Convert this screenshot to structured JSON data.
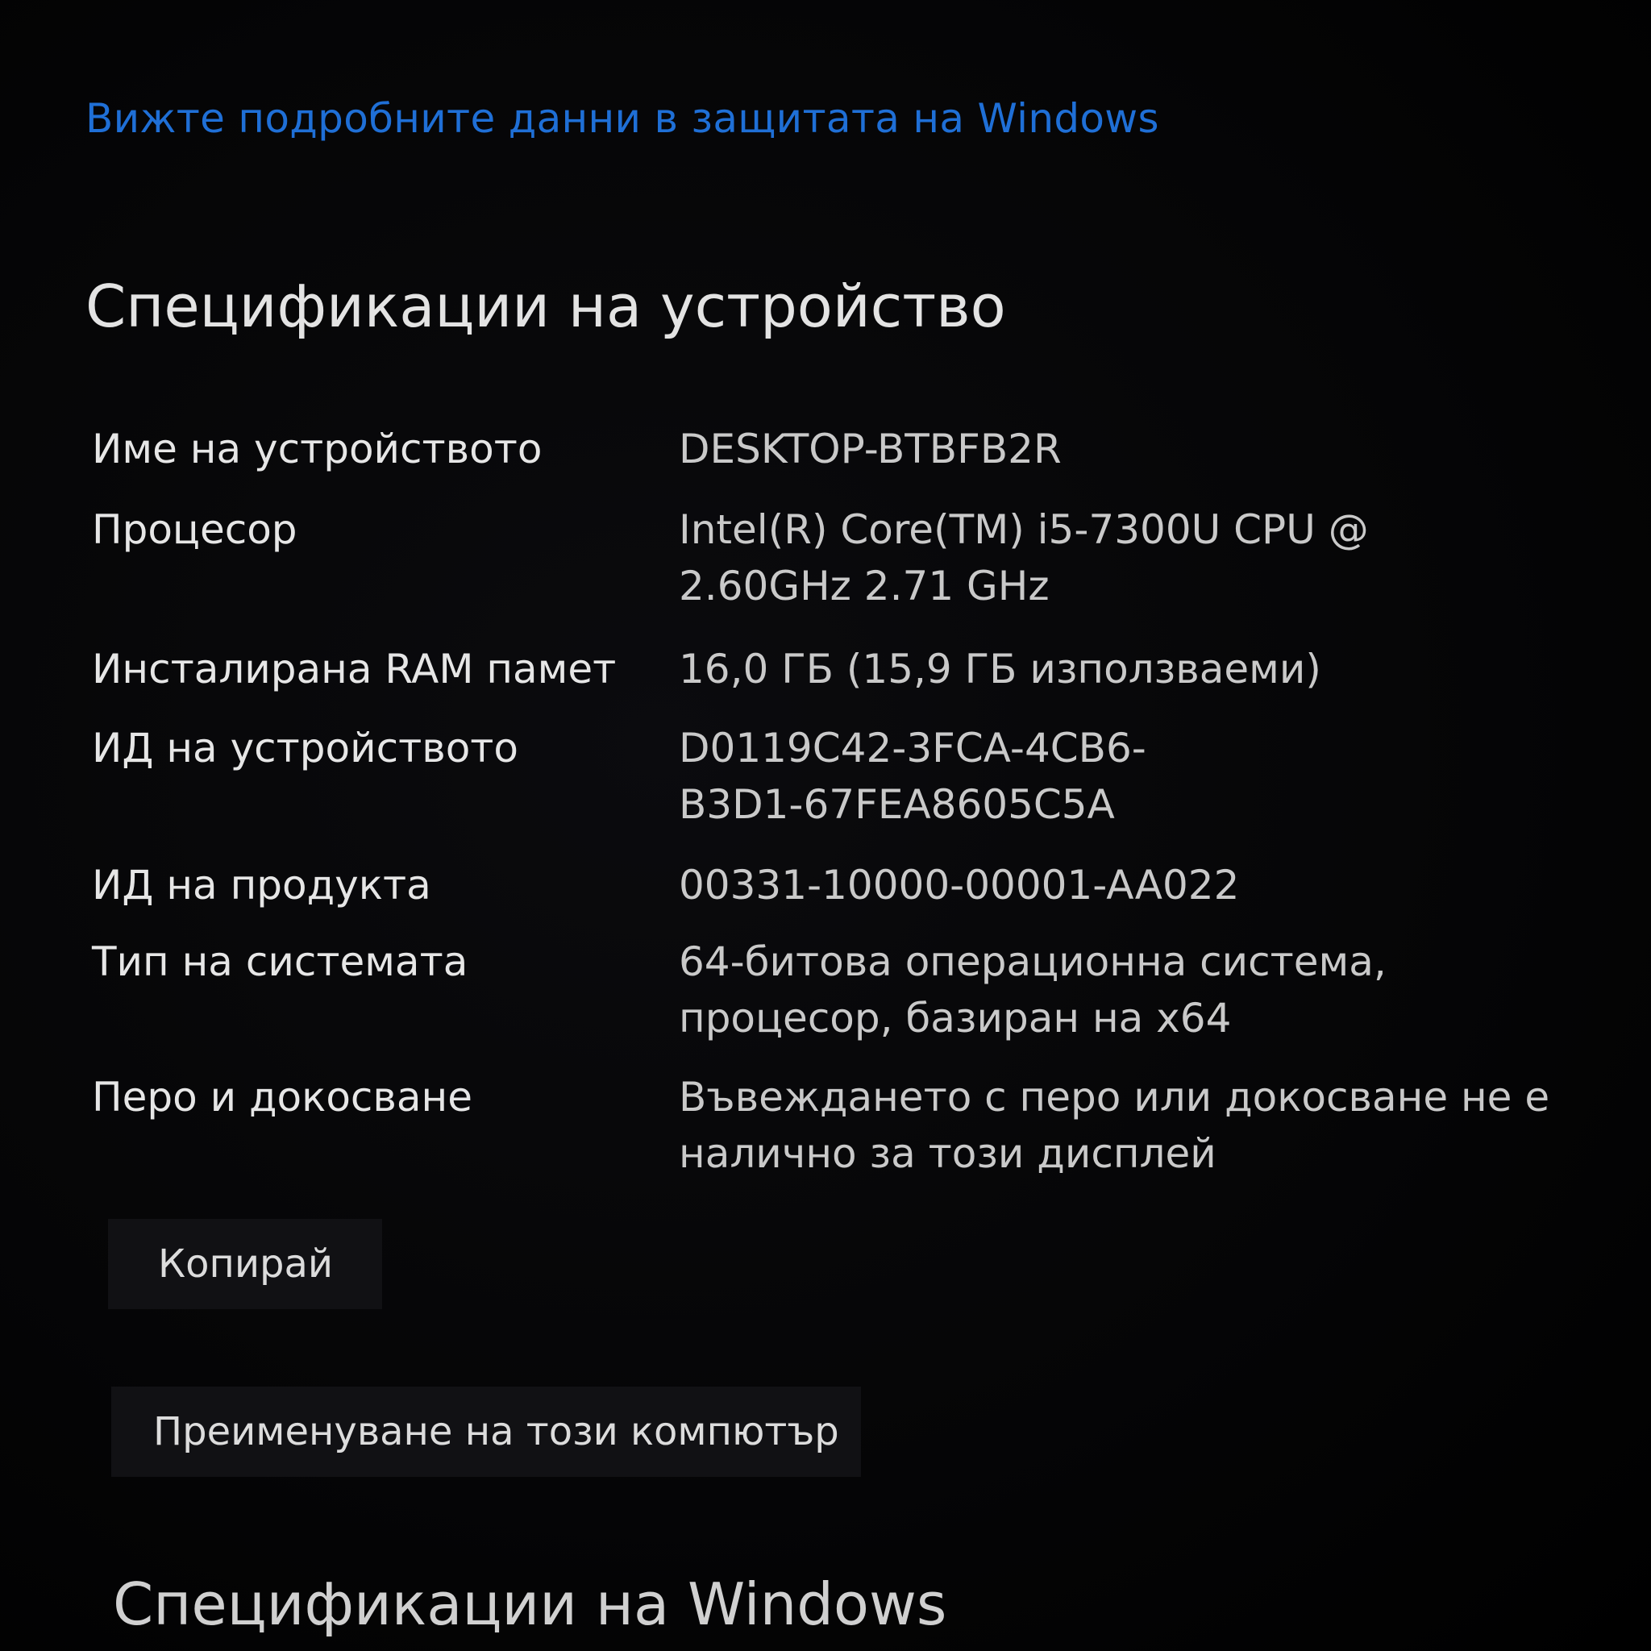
{
  "security_link": "Вижте подробните данни в защитата на Windows",
  "device_specs": {
    "title": "Спецификации на устройство",
    "rows": [
      {
        "label": "Име на устройството",
        "value": "DESKTOP-BTBFB2R"
      },
      {
        "label": "Процесор",
        "value": "Intel(R) Core(TM) i5-7300U CPU @\n2.60GHz   2.71 GHz"
      },
      {
        "label": "Инсталирана RAM памет",
        "value": "16,0 ГБ (15,9 ГБ използваеми)"
      },
      {
        "label": "ИД на устройството",
        "value": "D0119C42-3FCA-4CB6-\nB3D1-67FEA8605C5A"
      },
      {
        "label": "ИД на продукта",
        "value": "00331-10000-00001-AA022"
      },
      {
        "label": "Тип на системата",
        "value": "64-битова операционна система,\nпроцесор, базиран на x64"
      },
      {
        "label": "Перо и докосване",
        "value": "Въвеждането с перо или докосване не е\nналично за този дисплей"
      }
    ]
  },
  "buttons": {
    "copy": "Копирай",
    "rename": "Преименуване на този компютър"
  },
  "windows_specs": {
    "title": "Спецификации на Windows"
  }
}
